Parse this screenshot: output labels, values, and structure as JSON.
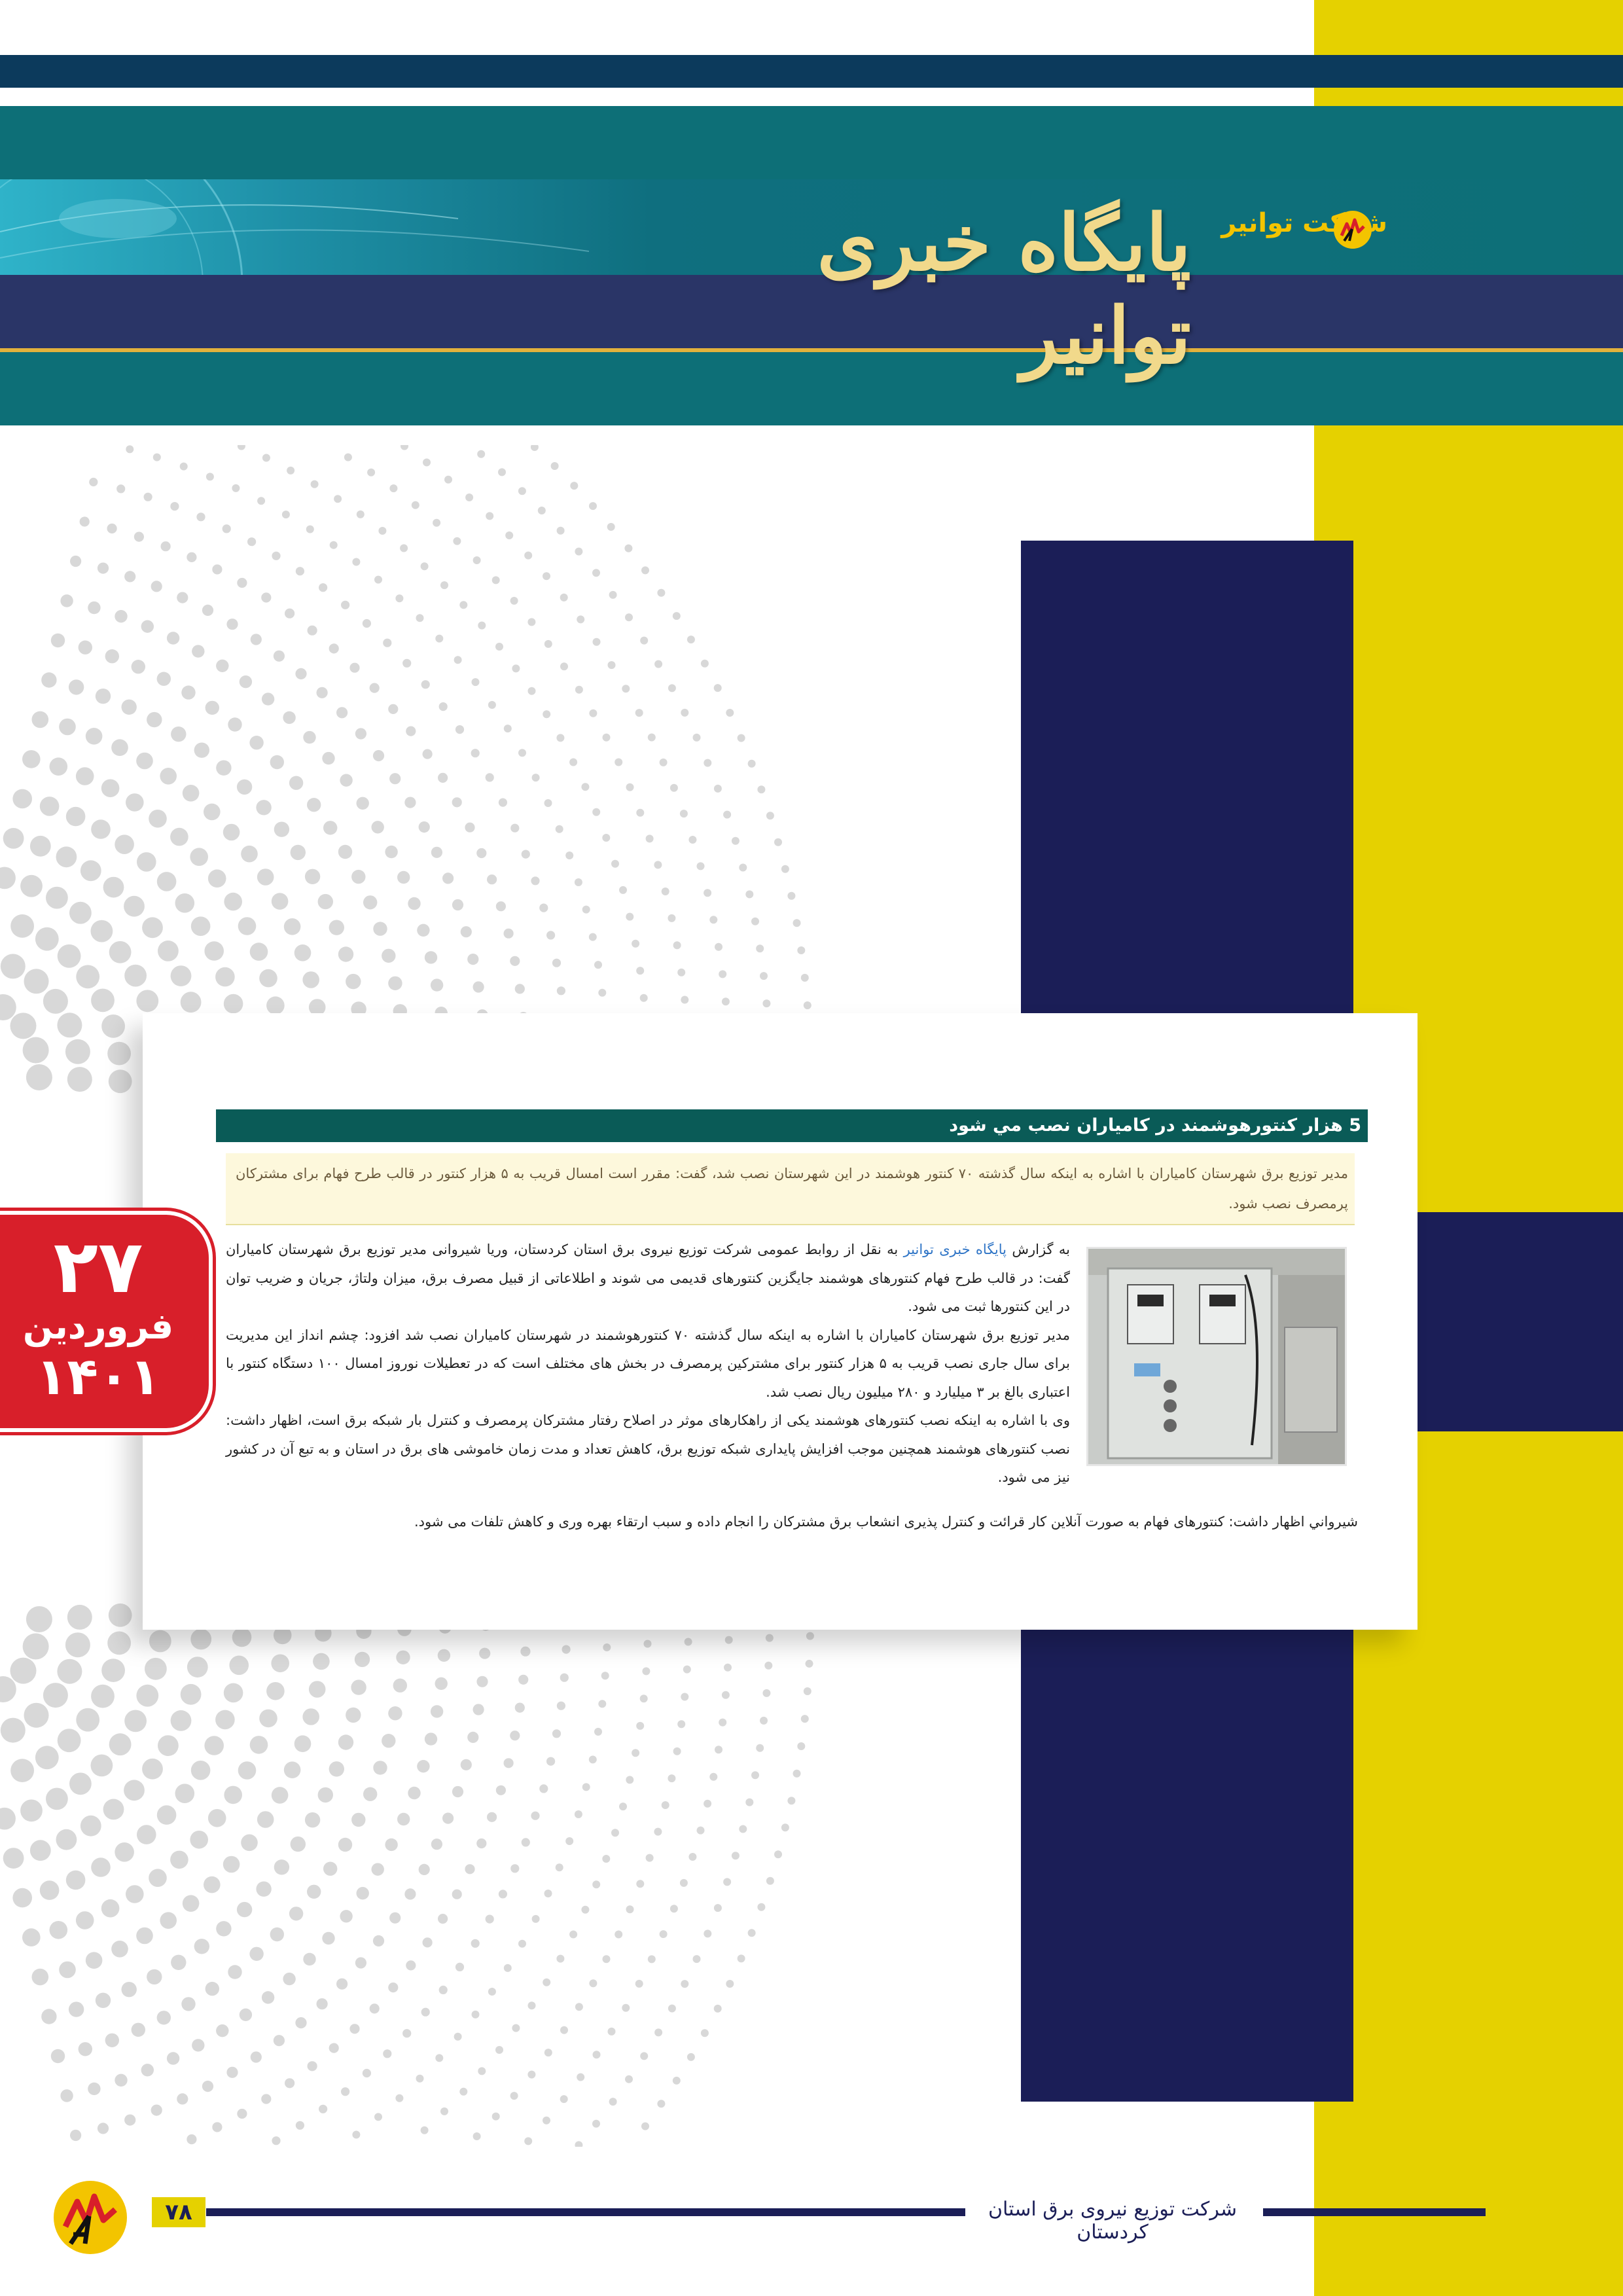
{
  "header": {
    "title": "پایگاه خبری توانیر",
    "brand": "شرکت توانیر"
  },
  "article": {
    "headline": "5 هزار کنتورهوشمند در کامیاران نصب مي شود",
    "lead": "مدیر توزیع برق شهرستان کامیاران با اشاره به اینکه سال گذشته ۷۰ کنتور هوشمند در این شهرستان نصب شد، گفت: مقرر است امسال قریب به ۵ هزار کنتور در قالب طرح فهام برای مشترکان پرمصرف نصب شود.",
    "body_intro": "به گزارش ",
    "body_link": "پایگاه خبری توانیر",
    "body_p1_rest": " به نقل از روابط عمومی شرکت توزیع نیروی برق استان کردستان، وریا شیروانی مدیر توزیع برق شهرستان کامیاران گفت: در قالب طرح فهام کنتورهای هوشمند جایگزین کنتورهای قدیمی می شوند و اطلاعاتی از قبیل مصرف برق، میزان ولتاژ، جریان و ضریب توان در این کنتورها ثبت می شود.",
    "body_p2": "مدیر توزیع برق شهرستان کامیاران با اشاره به اینکه سال گذشته ۷۰ کنتورهوشمند در شهرستان کامیاران نصب شد افزود: چشم انداز این مدیریت برای سال جاری نصب قریب به ۵ هزار کنتور برای مشترکین پرمصرف در بخش های مختلف است که در تعطیلات نوروز امسال ۱۰۰ دستگاه کنتور با اعتباری بالغ بر ۳ میلیارد و ۲۸۰ میلیون ریال نصب شد.",
    "body_p3": "وی با اشاره به اینکه نصب کنتورهای هوشمند یکی از راهکارهای موثر در اصلاح رفتار مشترکان پرمصرف و کنترل بار شبکه برق است، اظهار داشت: نصب کنتورهای هوشمند همچنین موجب افزایش پایداری شبکه توزیع برق، کاهش تعداد و مدت زمان خاموشی های برق در استان و به تبع آن در کشور نیز می شود.",
    "body_last": "شیرواني اظهار داشت: کنتورهای فهام به صورت آنلاین کار قرائت و کنترل پذیری انشعاب برق مشترکان را انجام داده و سبب ارتقاء بهره وری و کاهش تلفات می شود."
  },
  "date_badge": {
    "day": "۲۷",
    "month": "فروردین",
    "year": "۱۴۰۱"
  },
  "footer": {
    "page_number": "۷۸",
    "company": "شرکت توزیع نیروی برق استان کردستان"
  },
  "colors": {
    "yellow": "#e5d100",
    "navy": "#1b1e57",
    "teal": "#0d6f77",
    "headline_green": "#0a5b57",
    "badge_red": "#d81f2a",
    "title_gold": "#f1d98b"
  },
  "icons": {
    "logo": "tavanir-logo-icon",
    "photo": "smart-meter-cabinet-photo"
  }
}
